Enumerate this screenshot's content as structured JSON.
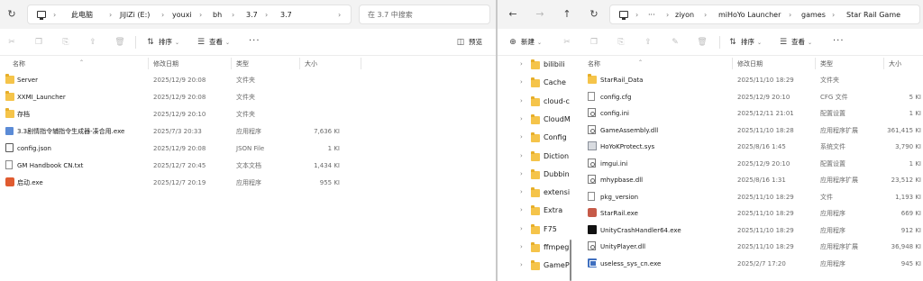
{
  "left": {
    "breadcrumb": [
      "此电脑",
      "JiJiZi (E:)",
      "youxi",
      "bh",
      "3.7",
      "3.7"
    ],
    "search_placeholder": "在 3.7 中搜索",
    "toolbar": {
      "sort_label": "排序",
      "view_label": "查看",
      "more_label": "···",
      "preview_label": "预览"
    },
    "columns": {
      "name": "名称",
      "date": "修改日期",
      "type": "类型",
      "size": "大小"
    },
    "files": [
      {
        "name": "Server",
        "date": "2025/12/9 20:08",
        "type": "文件夹",
        "size": "",
        "icon": "folder-icon"
      },
      {
        "name": "XXMI_Launcher",
        "date": "2025/12/9 20:08",
        "type": "文件夹",
        "size": "",
        "icon": "folder-icon"
      },
      {
        "name": "存档",
        "date": "2025/12/9 20:10",
        "type": "文件夹",
        "size": "",
        "icon": "folder-icon"
      },
      {
        "name": "3.3剧情指令辅指令生成器-凑合用.exe",
        "date": "2025/7/3 20:33",
        "type": "应用程序",
        "size": "7,636 KI",
        "icon": "exe-icon"
      },
      {
        "name": "config.json",
        "date": "2025/12/9 20:08",
        "type": "JSON File",
        "size": "1 KI",
        "icon": "json-file-icon"
      },
      {
        "name": "GM Handbook CN.txt",
        "date": "2025/12/7 20:45",
        "type": "文本文档",
        "size": "1,434 KI",
        "icon": "text-file-icon"
      },
      {
        "name": "启动.exe",
        "date": "2025/12/7 20:19",
        "type": "应用程序",
        "size": "955 KI",
        "icon": "launcher-exe-icon"
      }
    ]
  },
  "right": {
    "breadcrumb": [
      "ziyon",
      "miHoYo Launcher",
      "games",
      "Star Rail Game"
    ],
    "ellipsis": "···",
    "toolbar": {
      "new_label": "新建",
      "sort_label": "排序",
      "view_label": "查看",
      "more_label": "···"
    },
    "columns": {
      "name": "名称",
      "date": "修改日期",
      "type": "类型",
      "size": "大小"
    },
    "tree": [
      {
        "label": "bilibili",
        "icon": "folder-icon"
      },
      {
        "label": "Cache",
        "icon": "folder-icon"
      },
      {
        "label": "cloud-c",
        "icon": "folder-icon"
      },
      {
        "label": "CloudM",
        "icon": "folder-icon"
      },
      {
        "label": "Config",
        "icon": "folder-icon"
      },
      {
        "label": "Diction",
        "icon": "folder-icon"
      },
      {
        "label": "Dubbin",
        "icon": "folder-icon"
      },
      {
        "label": "extensi",
        "icon": "folder-icon"
      },
      {
        "label": "Extra",
        "icon": "folder-icon"
      },
      {
        "label": "F75",
        "icon": "folder-icon"
      },
      {
        "label": "ffmpeg",
        "icon": "folder-icon"
      },
      {
        "label": "GamePl",
        "icon": "folder-icon"
      }
    ],
    "files": [
      {
        "name": "StarRail_Data",
        "date": "2025/11/10 18:29",
        "type": "文件夹",
        "size": "",
        "icon": "folder-icon"
      },
      {
        "name": "config.cfg",
        "date": "2025/12/9 20:10",
        "type": "CFG 文件",
        "size": "5 KI",
        "icon": "file-icon"
      },
      {
        "name": "config.ini",
        "date": "2025/12/11 21:01",
        "type": "配置设置",
        "size": "1 KI",
        "icon": "settings-file-icon"
      },
      {
        "name": "GameAssembly.dll",
        "date": "2025/11/10 18:28",
        "type": "应用程序扩展",
        "size": "361,415 KI",
        "icon": "settings-file-icon"
      },
      {
        "name": "HoYoKProtect.sys",
        "date": "2025/8/16 1:45",
        "type": "系统文件",
        "size": "3,790 KI",
        "icon": "system-file-icon"
      },
      {
        "name": "imgui.ini",
        "date": "2025/12/9 20:10",
        "type": "配置设置",
        "size": "1 KI",
        "icon": "settings-file-icon"
      },
      {
        "name": "mhypbase.dll",
        "date": "2025/8/16 1:31",
        "type": "应用程序扩展",
        "size": "23,512 KI",
        "icon": "settings-file-icon"
      },
      {
        "name": "pkg_version",
        "date": "2025/11/10 18:29",
        "type": "文件",
        "size": "1,193 KI",
        "icon": "file-icon"
      },
      {
        "name": "StarRail.exe",
        "date": "2025/11/10 18:29",
        "type": "应用程序",
        "size": "669 KI",
        "icon": "star-rail-icon"
      },
      {
        "name": "UnityCrashHandler64.exe",
        "date": "2025/11/10 18:29",
        "type": "应用程序",
        "size": "912 KI",
        "icon": "unity-icon"
      },
      {
        "name": "UnityPlayer.dll",
        "date": "2025/11/10 18:29",
        "type": "应用程序扩展",
        "size": "36,948 KI",
        "icon": "settings-file-icon"
      },
      {
        "name": "useless_sys_cn.exe",
        "date": "2025/2/7 17:20",
        "type": "应用程序",
        "size": "945 KI",
        "icon": "cn-exe-icon"
      }
    ]
  }
}
